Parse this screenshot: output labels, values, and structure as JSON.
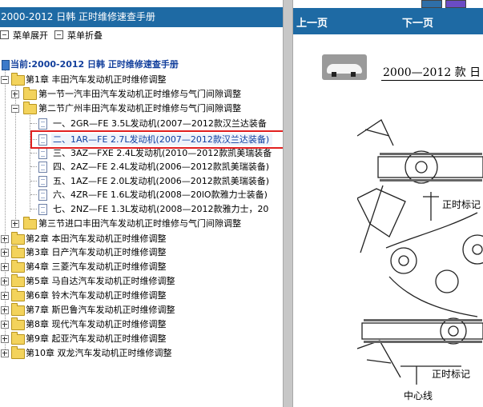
{
  "left_pane": {
    "title": "2000-2012 日韩 正时维修速查手册",
    "expand_all_label": "菜单展开",
    "collapse_all_label": "菜单折叠",
    "root_label": "当前:2000-2012 日韩 正时维修速查手册",
    "tree": [
      {
        "label": "第1章 丰田汽车发动机正时维修调整"
      },
      {
        "label": "第一节一汽丰田汽车发动机正时维修与气门间隙调整"
      },
      {
        "label": "第二节广州丰田汽车发动机正时维修与气门间隙调整"
      },
      {
        "label": "一、2GR—FE 3.5L发动机(2007—2012款汉兰达装备"
      },
      {
        "label": "二、1AR—FE 2.7L发动机(2007—2012款汉兰达装备)"
      },
      {
        "label": "三、3AZ—FXE 2.4L发动机(2010—2012款凯美瑞装备"
      },
      {
        "label": "四、2AZ—FE 2.4L发动机(2006—2012款凯美瑞装备)"
      },
      {
        "label": "五、1AZ—FE 2.0L发动机(2006—2012款凯美瑞装备)"
      },
      {
        "label": "六、4ZR—FE 1.6L发动机(2008—20lO款雅力士装备)"
      },
      {
        "label": "七、2NZ—FE 1.3L发动机(2008—2012款雅力士，20"
      },
      {
        "label": "第三节进口丰田汽车发动机正时维修与气门间隙调整"
      },
      {
        "label": "第2章 本田汽车发动机正时维修调整"
      },
      {
        "label": "第3章 日产汽车发动机正时维修调整"
      },
      {
        "label": "第4章 三菱汽车发动机正时维修调整"
      },
      {
        "label": "第5章 马自达汽车发动机正时维修调整"
      },
      {
        "label": "第6章 铃木汽车发动机正时维修调整"
      },
      {
        "label": "第7章 斯巴鲁汽车发动机正时维修调整"
      },
      {
        "label": "第8章 现代汽车发动机正时维修调整"
      },
      {
        "label": "第9章 起亚汽车发动机正时维修调整"
      },
      {
        "label": "第10章 双龙汽车发动机正时维修调整"
      }
    ],
    "selected_item": "二、1AR—FE 2.7L发动机(2007—2012款汉兰达装备)"
  },
  "right_pane": {
    "prev_label": "上一页",
    "next_label": "下一页",
    "doc_title": "2000—2012 款 日",
    "diagram_labels": {
      "timing_mark_1": "正时标记",
      "timing_mark_2": "正时标记",
      "center_line": "中心线"
    }
  },
  "colors": {
    "header_blue": "#1e6aa4",
    "highlight_red": "#e02020",
    "root_text": "#123f9c"
  }
}
